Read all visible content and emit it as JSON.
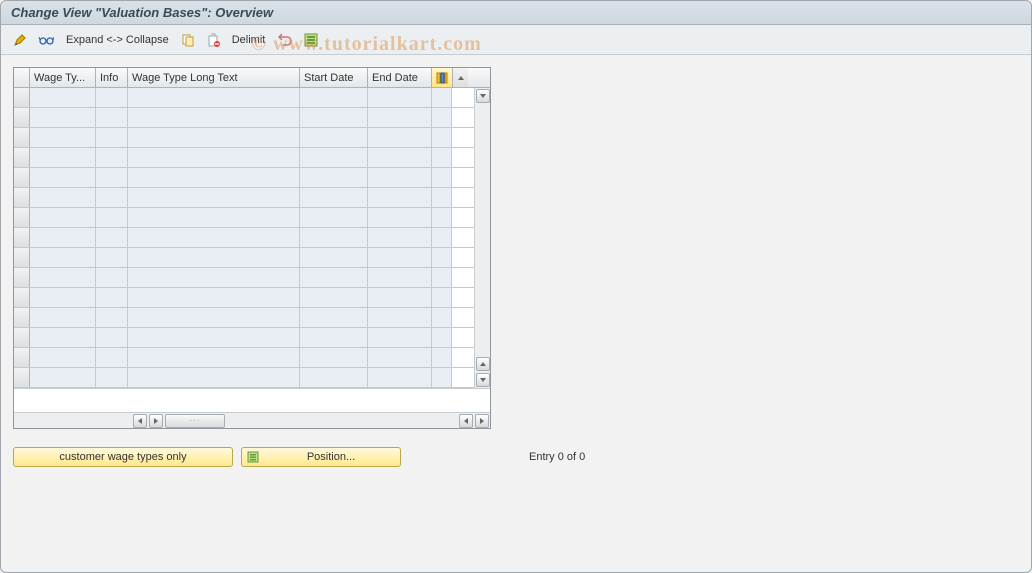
{
  "title": "Change View \"Valuation Bases\": Overview",
  "toolbar": {
    "expand_collapse": "Expand <-> Collapse",
    "delimit": "Delimit"
  },
  "grid": {
    "columns": {
      "wage_type": "Wage Ty...",
      "info": "Info",
      "long_text": "Wage Type Long Text",
      "start_date": "Start Date",
      "end_date": "End Date"
    },
    "row_count": 15
  },
  "footer": {
    "customer_btn": "customer wage types only",
    "position_btn": "Position...",
    "entry_text": "Entry 0 of 0"
  },
  "watermark": "© www.tutorialkart.com"
}
